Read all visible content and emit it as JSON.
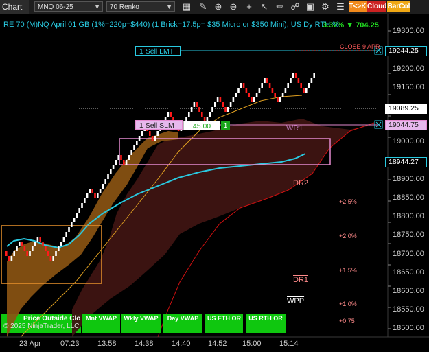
{
  "toolbar": {
    "tab_label": "Chart",
    "instrument": "MNQ 06-25",
    "bar_type": "70 Renko",
    "icons": [
      "bars-icon",
      "settings-icon",
      "zoom-in-icon",
      "zoom-out-icon",
      "crosshair-icon",
      "pointer-icon",
      "drawing-icon",
      "link-icon",
      "data-box-icon",
      "properties-icon",
      "strategies-icon",
      "list-icon"
    ],
    "btn_tck": "T<>K",
    "btn_cloud": "Cloud",
    "btn_barcol": "BarCol",
    "colors": {
      "tck": "#f28a1c",
      "cloud": "#cc2222",
      "barcol": "#f0a814"
    }
  },
  "chart": {
    "header_text": "RE 70 (M)NQ April 01 GB (1%=220p=$440) (1 Brick=17.5p= $35 Micro or $350 Mini), US Dy RTH %",
    "header_stat": "3.37% ▼ 704.25",
    "close_label": "CLOSE 9 APR",
    "order_sell_lmt": "1 Sell LMT",
    "order_sell_slm": "1 Sell SLM",
    "order_qty": "45.00",
    "order_count": "1",
    "labels": {
      "wr1": "WR1",
      "dr2": "DR2",
      "dr1": "DR1",
      "wpp": "WPP"
    },
    "pct_levels": [
      "+2.5%",
      "+2.0%",
      "+1.5%",
      "+1.0%",
      "+0.75"
    ],
    "price_labels": {
      "sell_lmt": "19244.25",
      "last": "19089.25",
      "sell_slm": "19044.75",
      "vwap": "18944.27"
    },
    "y_axis": [
      "19300.00",
      "19250.00",
      "19200.00",
      "19150.00",
      "19100.00",
      "19050.00",
      "19000.00",
      "18950.00",
      "18900.00",
      "18850.00",
      "18800.00",
      "18750.00",
      "18700.00",
      "18650.00",
      "18600.00",
      "18550.00",
      "18500.00"
    ],
    "x_axis": [
      "23 Apr",
      "07:23",
      "13:58",
      "14:38",
      "14:40",
      "14:52",
      "15:00",
      "15:14"
    ],
    "buttons": [
      "Mnt VWAP",
      "Wkly VWAP",
      "Day VWAP",
      "US ETH OR",
      "US RTH OR"
    ],
    "price_outside": "Price Outside Clo",
    "copyright": "© 2025 NinjaTrader, LLC",
    "colors": {
      "bull": "#ffffff",
      "bear": "#ff1a1a",
      "vwap": "#29c9e0",
      "cloud_bull": "#8a5412",
      "cloud_bear": "#3e1412",
      "ma_line": "#e0a020",
      "box_orange": "#e8912c",
      "box_pink": "#e58ad0"
    }
  }
}
